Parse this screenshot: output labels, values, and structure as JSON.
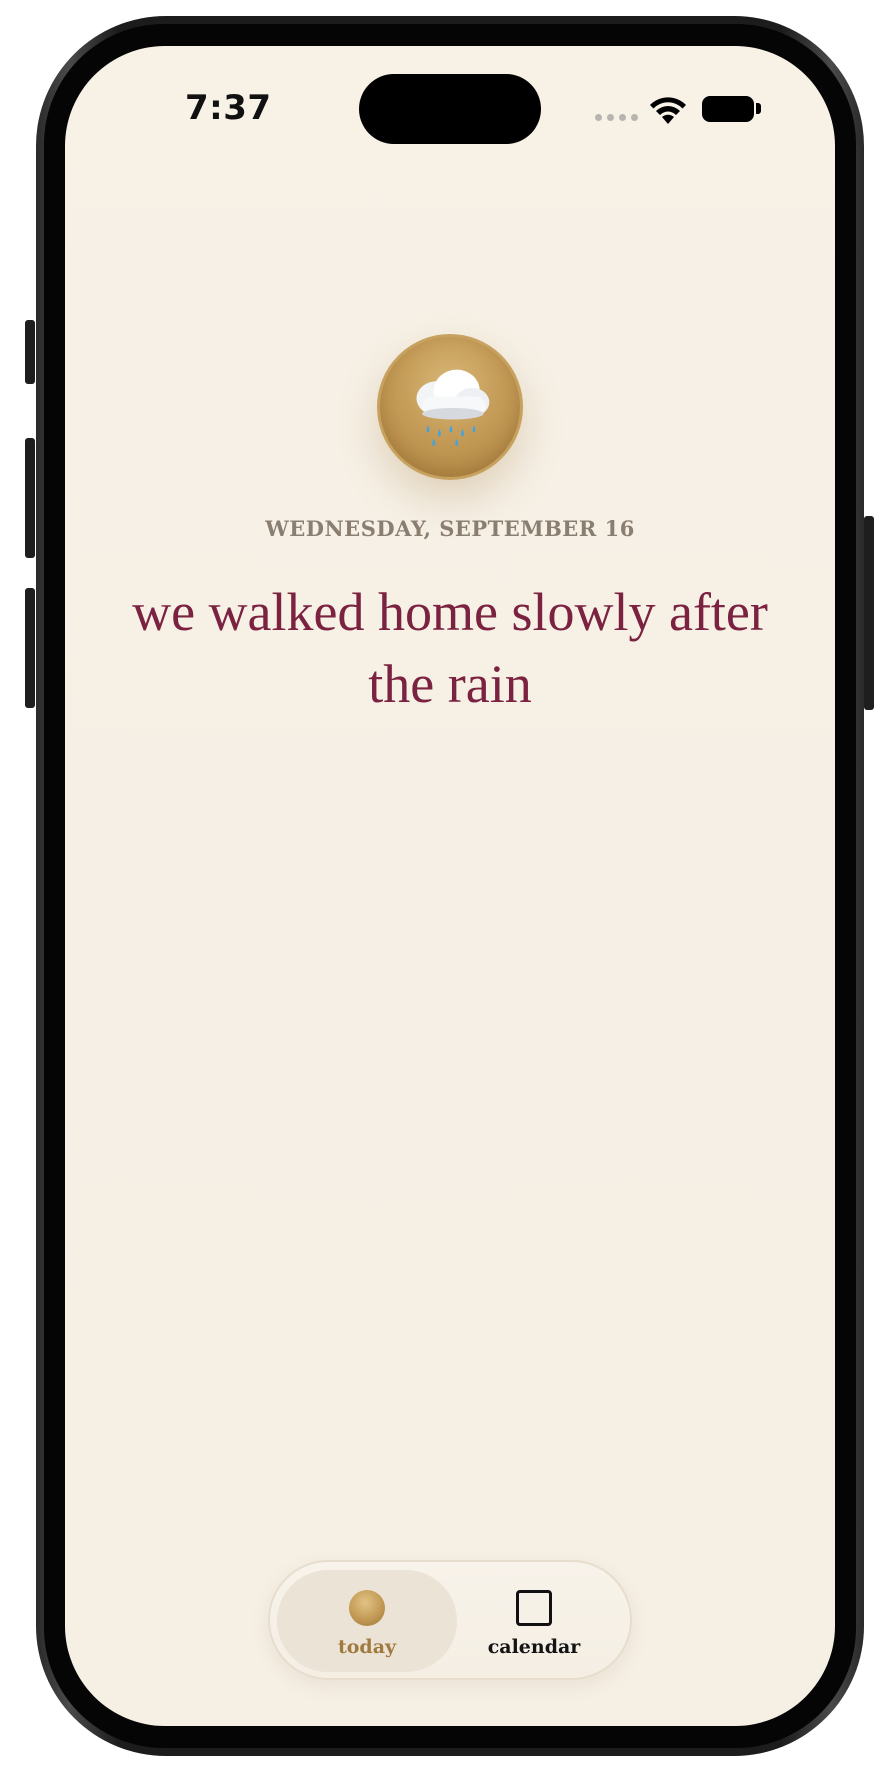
{
  "status_bar": {
    "time": "7:37"
  },
  "entry": {
    "mood_icon": "rain-cloud-emoji",
    "date_label": "WEDNESDAY, SEPTEMBER 16",
    "text": "we walked home slowly after the rain"
  },
  "tabbar": {
    "tabs": [
      {
        "label": "today",
        "icon": "orb-icon",
        "selected": true
      },
      {
        "label": "calendar",
        "icon": "square-icon",
        "selected": false
      }
    ]
  },
  "colors": {
    "background": "#f6efe4",
    "accent_gold": "#c49b57",
    "entry_text": "#7a2240",
    "date_text": "#8a7e71"
  }
}
